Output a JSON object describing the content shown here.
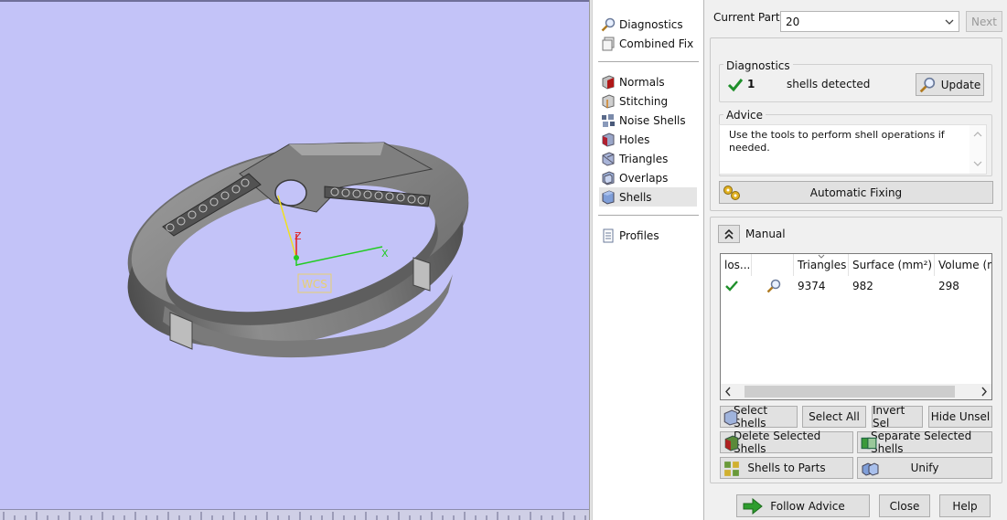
{
  "nav": {
    "items": [
      {
        "label": "Diagnostics",
        "icon": "magnifier-icon"
      },
      {
        "label": "Combined Fix",
        "icon": "combined-fix-icon"
      },
      {
        "label": "Normals",
        "icon": "normals-cube-icon"
      },
      {
        "label": "Stitching",
        "icon": "stitching-cube-icon"
      },
      {
        "label": "Noise Shells",
        "icon": "noise-shells-icon"
      },
      {
        "label": "Holes",
        "icon": "holes-cube-icon"
      },
      {
        "label": "Triangles",
        "icon": "triangles-cube-icon"
      },
      {
        "label": "Overlaps",
        "icon": "overlaps-cube-icon"
      },
      {
        "label": "Shells",
        "icon": "shells-cube-icon",
        "selected": true
      },
      {
        "label": "Profiles",
        "icon": "document-icon"
      }
    ]
  },
  "part": {
    "label": "Current Part:",
    "value": "20",
    "next_label": "Next"
  },
  "diagnostics": {
    "title": "Diagnostics",
    "count": "1",
    "count_label": "shells detected",
    "update_label": "Update"
  },
  "advice": {
    "title": "Advice",
    "text": "Use the tools to perform shell operations if needed."
  },
  "automatic_fixing_label": "Automatic Fixing",
  "manual": {
    "label": "Manual",
    "columns": [
      "los...",
      "",
      "Triangles",
      "Surface (mm²)",
      "Volume (m"
    ],
    "rows": [
      {
        "closed": "check",
        "triangles": "9374",
        "surface": "982",
        "volume": "298"
      }
    ]
  },
  "buttons": {
    "select_shells": "Select Shells",
    "select_all": "Select All",
    "invert_sel": "Invert Sel",
    "hide_unsel": "Hide Unsel",
    "delete_selected_shells": "Delete Selected Shells",
    "separate_selected_shells": "Separate Selected Shells",
    "shells_to_parts": "Shells to Parts",
    "unify": "Unify"
  },
  "footer": {
    "follow_advice": "Follow Advice",
    "close": "Close",
    "help": "Help"
  },
  "viewport": {
    "axis_z": "Z",
    "axis_x": "X",
    "wcs_label": "WCS"
  },
  "colors": {
    "viewport_bg": "#c3c3f8",
    "model": "#8a8a8a",
    "check_green": "#1e8f2a",
    "arrow_green": "#2e9d2e",
    "axis_yellow": "#f0e020",
    "axis_green": "#22cc22",
    "axis_red": "#e02020",
    "wcs_color": "#e8d070"
  }
}
